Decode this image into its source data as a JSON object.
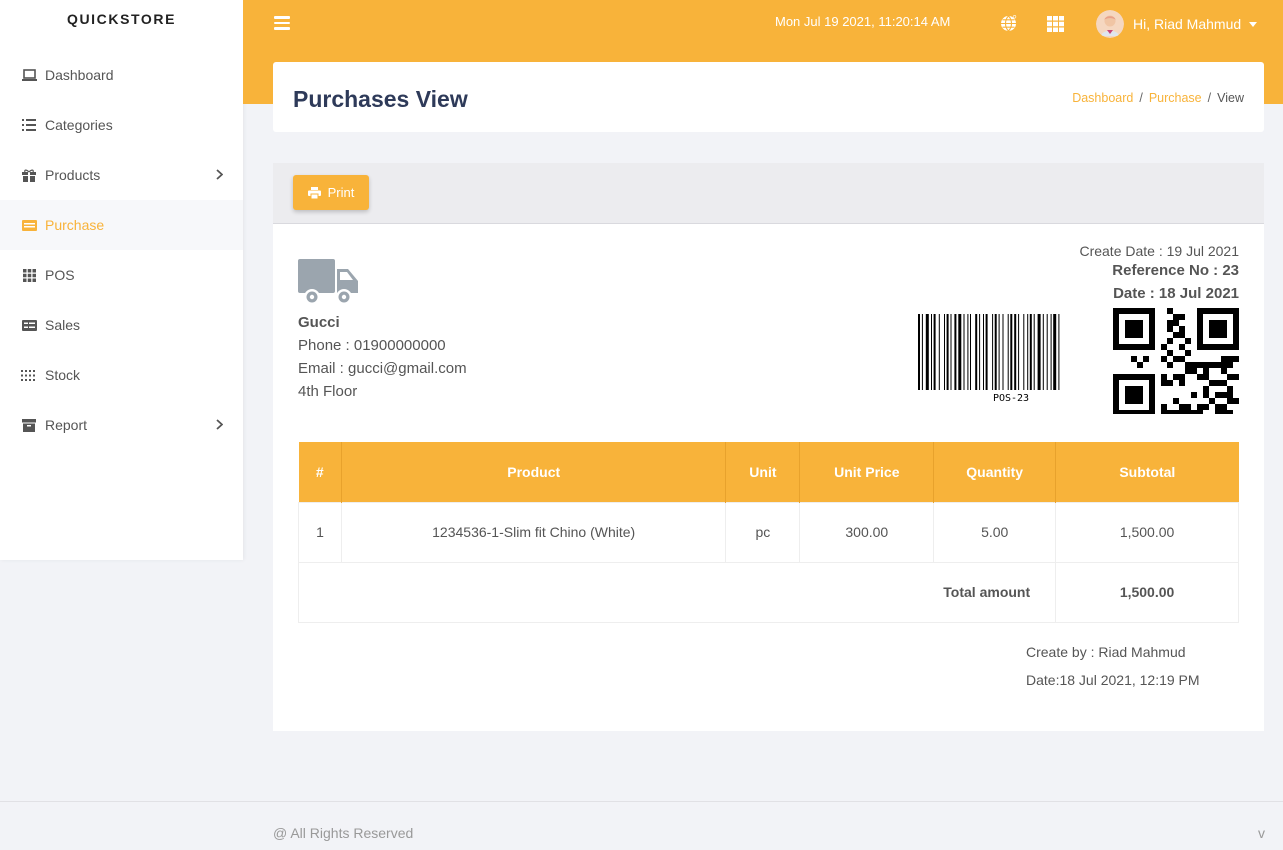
{
  "brand": "QUICKSTORE",
  "sidebar": {
    "items": [
      {
        "label": "Dashboard",
        "icon": "laptop-icon"
      },
      {
        "label": "Categories",
        "icon": "list-icon"
      },
      {
        "label": "Products",
        "icon": "gift-icon",
        "has_submenu": true
      },
      {
        "label": "Purchase",
        "icon": "credit-card-icon",
        "active": true
      },
      {
        "label": "POS",
        "icon": "grid-icon"
      },
      {
        "label": "Sales",
        "icon": "receipt-icon"
      },
      {
        "label": "Stock",
        "icon": "dots-grid-icon"
      },
      {
        "label": "Report",
        "icon": "archive-icon",
        "has_submenu": true
      }
    ]
  },
  "header": {
    "datetime": "Mon Jul 19 2021, 11:20:14 AM",
    "user_name": "Hi, Riad Mahmud"
  },
  "page": {
    "title": "Purchases View",
    "breadcrumb": {
      "dashboard": "Dashboard",
      "purchase": "Purchase",
      "current": "View"
    }
  },
  "toolbar": {
    "print_label": "Print"
  },
  "supplier": {
    "name": "Gucci",
    "phone": "Phone : 01900000000",
    "email": "Email : gucci@gmail.com",
    "address": "4th Floor"
  },
  "meta": {
    "create_date": "Create Date : 19 Jul 2021",
    "reference": "Reference No : 23",
    "date": "Date : 18 Jul 2021",
    "barcode_text": "POS-23"
  },
  "table": {
    "headers": {
      "num": "#",
      "product": "Product",
      "unit": "Unit",
      "unit_price": "Unit Price",
      "quantity": "Quantity",
      "subtotal": "Subtotal"
    },
    "rows": [
      {
        "num": "1",
        "product": "1234536-1-Slim fit Chino (White)",
        "unit": "pc",
        "unit_price": "300.00",
        "quantity": "5.00",
        "subtotal": "1,500.00"
      }
    ],
    "total_label": "Total amount",
    "total_value": "1,500.00"
  },
  "created": {
    "by": "Create by : Riad Mahmud",
    "date": "Date:18 Jul 2021, 12:19 PM"
  },
  "footer": {
    "text": "@ All Rights Reserved",
    "version": "v"
  },
  "colors": {
    "accent": "#f8b33a",
    "title": "#2e3a59"
  }
}
